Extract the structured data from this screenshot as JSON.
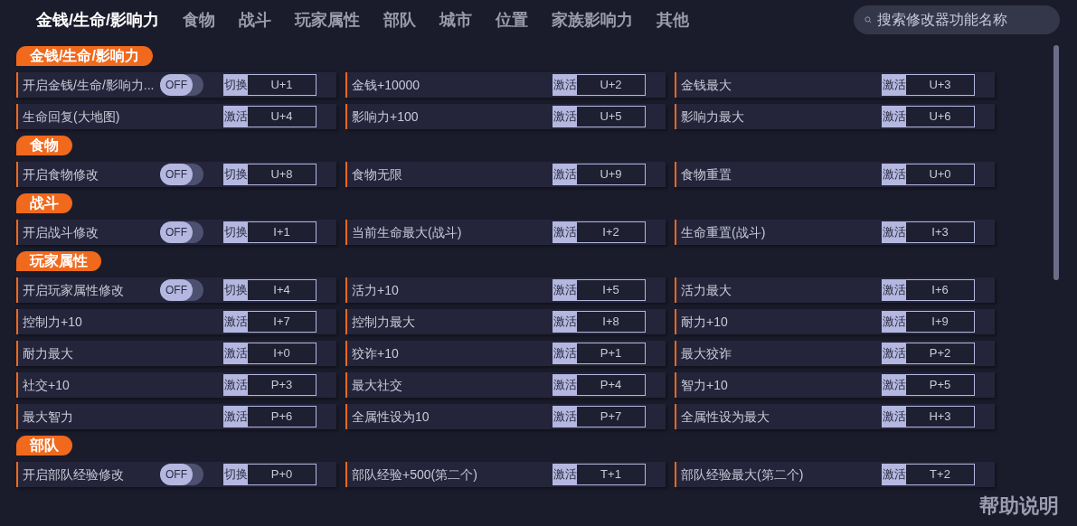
{
  "tabs": [
    {
      "label": "金钱/生命/影响力",
      "selected": true
    },
    {
      "label": "食物",
      "selected": false
    },
    {
      "label": "战斗",
      "selected": false
    },
    {
      "label": "玩家属性",
      "selected": false
    },
    {
      "label": "部队",
      "selected": false
    },
    {
      "label": "城市",
      "selected": false
    },
    {
      "label": "位置",
      "selected": false
    },
    {
      "label": "家族影响力",
      "selected": false
    },
    {
      "label": "其他",
      "selected": false
    }
  ],
  "search": {
    "placeholder": "搜索修改器功能名称"
  },
  "sections": [
    {
      "title": "金钱/生命/影响力",
      "items": [
        {
          "kind": "toggle",
          "label": "开启金钱/生命/影响力...",
          "on": false,
          "state_text": "OFF",
          "action": "切换",
          "key": "U+1"
        },
        {
          "kind": "button",
          "label": "金钱+10000",
          "action": "激活",
          "key": "U+2"
        },
        {
          "kind": "button",
          "label": "金钱最大",
          "action": "激活",
          "key": "U+3"
        },
        {
          "kind": "button",
          "label": "生命回复(大地图)",
          "action": "激活",
          "key": "U+4"
        },
        {
          "kind": "button",
          "label": "影响力+100",
          "action": "激活",
          "key": "U+5"
        },
        {
          "kind": "button",
          "label": "影响力最大",
          "action": "激活",
          "key": "U+6"
        }
      ]
    },
    {
      "title": "食物",
      "items": [
        {
          "kind": "toggle",
          "label": "开启食物修改",
          "on": false,
          "state_text": "OFF",
          "action": "切换",
          "key": "U+8"
        },
        {
          "kind": "button",
          "label": "食物无限",
          "action": "激活",
          "key": "U+9"
        },
        {
          "kind": "button",
          "label": "食物重置",
          "action": "激活",
          "key": "U+0"
        }
      ]
    },
    {
      "title": "战斗",
      "items": [
        {
          "kind": "toggle",
          "label": "开启战斗修改",
          "on": false,
          "state_text": "OFF",
          "action": "切换",
          "key": "I+1"
        },
        {
          "kind": "button",
          "label": "当前生命最大(战斗)",
          "action": "激活",
          "key": "I+2"
        },
        {
          "kind": "button",
          "label": "生命重置(战斗)",
          "action": "激活",
          "key": "I+3"
        }
      ]
    },
    {
      "title": "玩家属性",
      "items": [
        {
          "kind": "toggle",
          "label": "开启玩家属性修改",
          "on": false,
          "state_text": "OFF",
          "action": "切换",
          "key": "I+4"
        },
        {
          "kind": "button",
          "label": "活力+10",
          "action": "激活",
          "key": "I+5"
        },
        {
          "kind": "button",
          "label": "活力最大",
          "action": "激活",
          "key": "I+6"
        },
        {
          "kind": "button",
          "label": "控制力+10",
          "action": "激活",
          "key": "I+7"
        },
        {
          "kind": "button",
          "label": "控制力最大",
          "action": "激活",
          "key": "I+8"
        },
        {
          "kind": "button",
          "label": "耐力+10",
          "action": "激活",
          "key": "I+9"
        },
        {
          "kind": "button",
          "label": "耐力最大",
          "action": "激活",
          "key": "I+0"
        },
        {
          "kind": "button",
          "label": "狡诈+10",
          "action": "激活",
          "key": "P+1"
        },
        {
          "kind": "button",
          "label": "最大狡诈",
          "action": "激活",
          "key": "P+2"
        },
        {
          "kind": "button",
          "label": "社交+10",
          "action": "激活",
          "key": "P+3"
        },
        {
          "kind": "button",
          "label": "最大社交",
          "action": "激活",
          "key": "P+4"
        },
        {
          "kind": "button",
          "label": "智力+10",
          "action": "激活",
          "key": "P+5"
        },
        {
          "kind": "button",
          "label": "最大智力",
          "action": "激活",
          "key": "P+6"
        },
        {
          "kind": "button",
          "label": "全属性设为10",
          "action": "激活",
          "key": "P+7"
        },
        {
          "kind": "button",
          "label": "全属性设为最大",
          "action": "激活",
          "key": "H+3"
        }
      ]
    },
    {
      "title": "部队",
      "items": [
        {
          "kind": "toggle",
          "label": "开启部队经验修改",
          "on": false,
          "state_text": "OFF",
          "action": "切换",
          "key": "P+0"
        },
        {
          "kind": "button",
          "label": "部队经验+500(第二个)",
          "action": "激活",
          "key": "T+1"
        },
        {
          "kind": "button",
          "label": "部队经验最大(第二个)",
          "action": "激活",
          "key": "T+2"
        }
      ]
    }
  ],
  "help": "帮助说明"
}
